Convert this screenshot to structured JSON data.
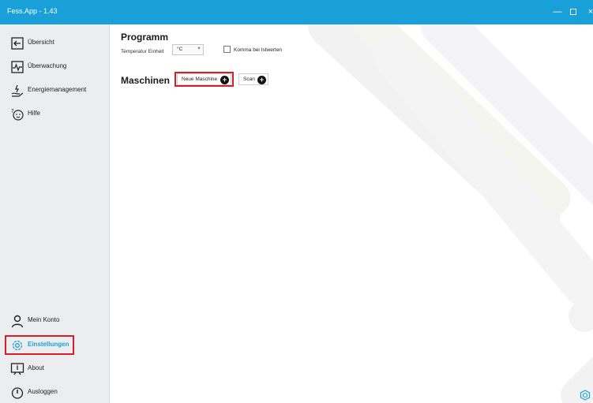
{
  "titlebar": {
    "title": "Fess.App - 1.43",
    "minimize_icon": "minimize-icon",
    "maximize_icon": "maximize-icon",
    "close_icon": "close-icon",
    "minimize_glyph": "—",
    "close_glyph": "×"
  },
  "sidebar": {
    "items": [
      {
        "label": "Übersicht",
        "icon": "arrow-left-box-icon"
      },
      {
        "label": "Überwachung",
        "icon": "monitor-pulse-icon"
      },
      {
        "label": "Energiemanagement",
        "icon": "energy-hand-icon"
      },
      {
        "label": "Hilfe",
        "icon": "help-icon"
      }
    ],
    "bottom_items": [
      {
        "label": "Mein Konto",
        "icon": "user-icon"
      },
      {
        "label": "Einstellungen",
        "icon": "gear-icon",
        "active": true
      },
      {
        "label": "About",
        "icon": "info-board-icon"
      },
      {
        "label": "Ausloggen",
        "icon": "power-icon"
      }
    ]
  },
  "main": {
    "programm_title": "Programm",
    "temp_label": "Temperatur Einheit",
    "temp_value": "°C",
    "komma_label": "Komma bei Istwerten",
    "maschinen_title": "Maschinen",
    "new_machine_label": "Neue Maschine",
    "scan_label": "Scan"
  },
  "colors": {
    "accent": "#1aa0d8",
    "highlight": "#d81e2c",
    "sidebar_bg": "#ecedef"
  }
}
